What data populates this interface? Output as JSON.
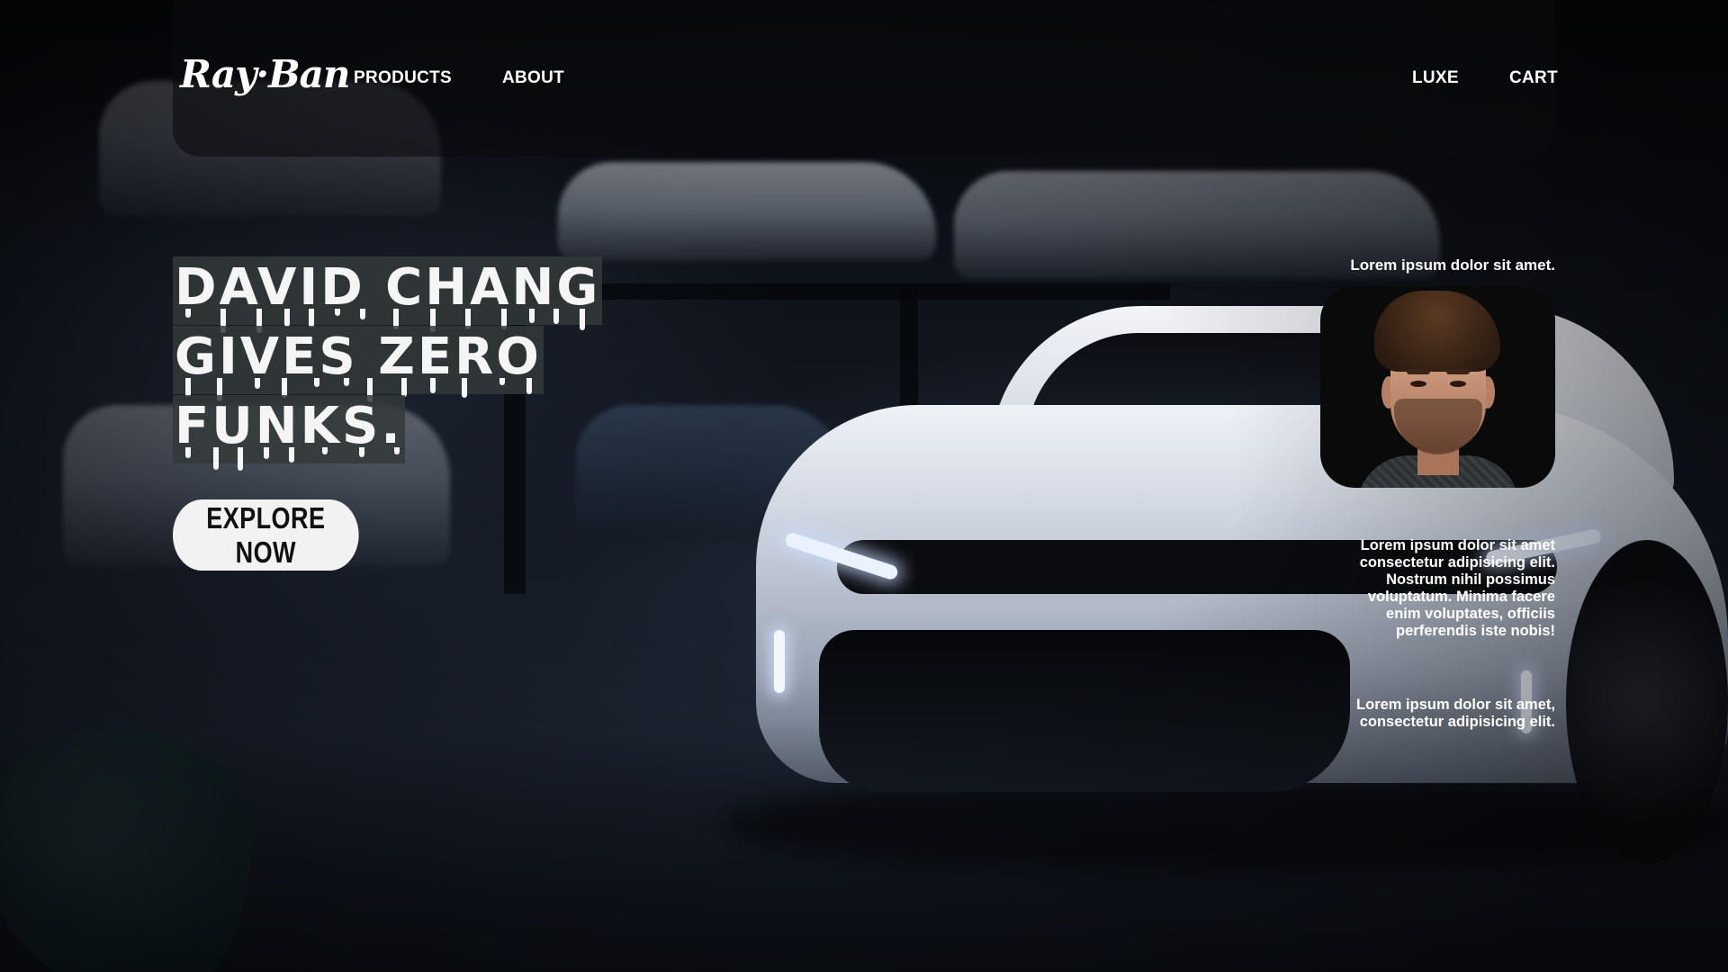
{
  "brand": {
    "logo_text": "Ray·Ban"
  },
  "nav": {
    "left": [
      "PRODUCTS",
      "ABOUT"
    ],
    "right": [
      "LUXE",
      "CART"
    ]
  },
  "hero": {
    "headline_lines": [
      "DAVID CHANG",
      "GIVES ZERO",
      "FUNKS."
    ],
    "cta_label": "EXPLORE NOW"
  },
  "side": {
    "title": "Lorem ipsum dolor sit amet.",
    "paragraph_1": "Lorem ipsum dolor sit amet consectetur adipisicing elit. Nostrum nihil possimus voluptatum. Minima facere enim voluptates, officiis perferendis iste nobis!",
    "paragraph_2": "Lorem ipsum dolor sit amet, consectetur adipisicing elit."
  },
  "icons": {
    "avatar": "person-portrait-icon",
    "logo": "rayban-logo-icon"
  },
  "colors": {
    "cta_bg": "#f2f2f2",
    "nav_bg": "#0c0c0e",
    "headline_bg": "#343a3a",
    "accent_white": "#ffffff"
  }
}
